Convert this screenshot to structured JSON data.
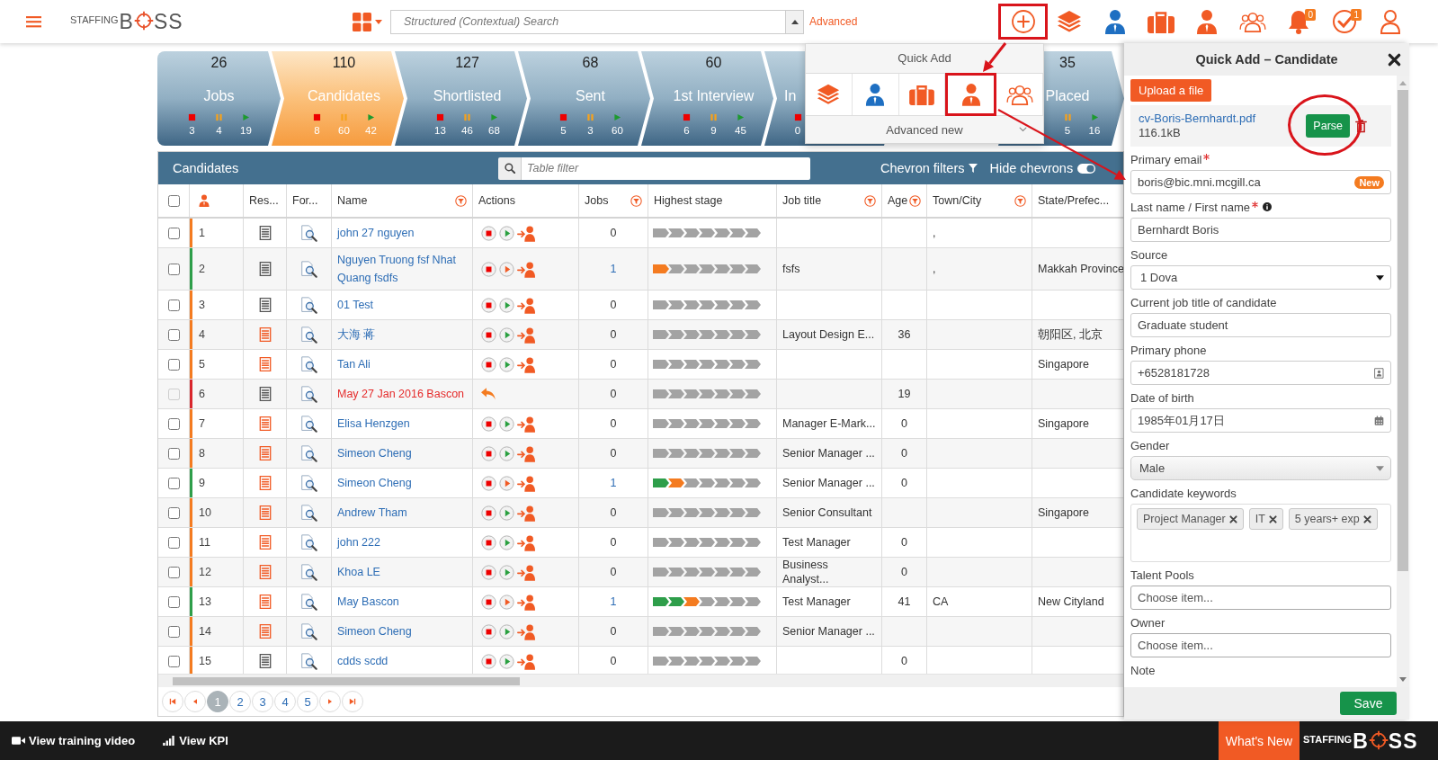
{
  "topbar": {
    "logo": {
      "small": "STAFFING",
      "left": "B",
      "right": "SS"
    },
    "search": {
      "placeholder": "Structured (Contextual) Search"
    },
    "advanced_link": "Advanced",
    "icons": [
      {
        "kind": "add",
        "highlighted": true
      },
      {
        "kind": "layers",
        "highlighted": false
      },
      {
        "kind": "person-blue",
        "highlighted": false
      },
      {
        "kind": "briefcase",
        "highlighted": false
      },
      {
        "kind": "person",
        "highlighted": false
      },
      {
        "kind": "group",
        "highlighted": false
      },
      {
        "kind": "bell",
        "highlighted": false,
        "badge": "0"
      },
      {
        "kind": "check",
        "highlighted": false,
        "badge": "1"
      },
      {
        "kind": "user",
        "highlighted": false
      }
    ]
  },
  "chevrons": [
    {
      "count": "26",
      "label": "Jobs",
      "selected": false,
      "stats": [
        {
          "kind": "stopped",
          "value": "3"
        },
        {
          "kind": "paused",
          "value": "4"
        },
        {
          "kind": "running",
          "value": "19"
        }
      ]
    },
    {
      "count": "110",
      "label": "Candidates",
      "selected": true,
      "stats": [
        {
          "kind": "stopped",
          "value": "8"
        },
        {
          "kind": "paused",
          "value": "60"
        },
        {
          "kind": "running",
          "value": "42"
        }
      ]
    },
    {
      "count": "127",
      "label": "Shortlisted",
      "selected": false,
      "stats": [
        {
          "kind": "stopped",
          "value": "13"
        },
        {
          "kind": "paused",
          "value": "46"
        },
        {
          "kind": "running",
          "value": "68"
        }
      ]
    },
    {
      "count": "68",
      "label": "Sent",
      "selected": false,
      "stats": [
        {
          "kind": "stopped",
          "value": "5"
        },
        {
          "kind": "paused",
          "value": "3"
        },
        {
          "kind": "running",
          "value": "60"
        }
      ]
    },
    {
      "count": "60",
      "label": "1st Interview",
      "selected": false,
      "stats": [
        {
          "kind": "stopped",
          "value": "6"
        },
        {
          "kind": "paused",
          "value": "9"
        },
        {
          "kind": "running",
          "value": "45"
        }
      ]
    },
    {
      "label": "In",
      "selected": false,
      "stats": [
        {
          "kind": "stopped",
          "value": "0"
        }
      ]
    },
    {
      "count": "35",
      "label": "Placed",
      "selected": false,
      "stats": [
        {
          "kind": "paused",
          "value": "5"
        },
        {
          "kind": "running",
          "value": "16"
        }
      ]
    }
  ],
  "quick_add": {
    "title": "Quick Add",
    "items": [
      {
        "kind": "layers",
        "highlighted": false
      },
      {
        "kind": "person-blue",
        "highlighted": false
      },
      {
        "kind": "briefcase",
        "highlighted": false
      },
      {
        "kind": "person",
        "highlighted": true
      },
      {
        "kind": "group",
        "highlighted": false
      }
    ],
    "advanced": "Advanced new"
  },
  "table": {
    "title": "Candidates",
    "filter_placeholder": "Table filter",
    "chevron_filters": "Chevron filters",
    "hide_chevrons": "Hide chevrons",
    "columns": [
      {
        "kind": "checkbox",
        "checked": false
      },
      {
        "kind": "person"
      },
      {
        "kind": "text",
        "title": "Res..."
      },
      {
        "kind": "text",
        "title": "For..."
      },
      {
        "kind": "text",
        "title": "Name",
        "filter": true
      },
      {
        "kind": "text",
        "title": "Actions"
      },
      {
        "kind": "text",
        "title": "Jobs",
        "filter": true
      },
      {
        "kind": "text",
        "title": "Highest stage"
      },
      {
        "kind": "text",
        "title": "Job title",
        "filter": true
      },
      {
        "kind": "text",
        "title": "Age",
        "filter": true
      },
      {
        "kind": "text",
        "title": "Town/City",
        "filter": true
      },
      {
        "kind": "text",
        "title": "State/Prefec..."
      }
    ],
    "rows": [
      {
        "number": "1",
        "color": "#f47b20",
        "checked": false,
        "kind": "active",
        "resume_parsed": false,
        "name": "john 27 nguyen",
        "pipeline": false,
        "jobs": "0",
        "stages": [
          {
            "color": "#a3a3a3"
          },
          {
            "color": "#a3a3a3"
          },
          {
            "color": "#a3a3a3"
          },
          {
            "color": "#a3a3a3"
          },
          {
            "color": "#a3a3a3"
          },
          {
            "color": "#a3a3a3"
          },
          {
            "color": "#a3a3a3"
          }
        ],
        "town": ","
      },
      {
        "number": "2",
        "color": "#2e9e4a",
        "checked": false,
        "kind": "active",
        "resume_parsed": false,
        "name": "Nguyen Truong fsf Nhat Quang fsdfs",
        "pipeline": true,
        "jobs": "1",
        "stages": [
          {
            "color": "#f47b20"
          },
          {
            "color": "#a3a3a3"
          },
          {
            "color": "#a3a3a3"
          },
          {
            "color": "#a3a3a3"
          },
          {
            "color": "#a3a3a3"
          },
          {
            "color": "#a3a3a3"
          },
          {
            "color": "#a3a3a3"
          }
        ],
        "job_title": "fsfs",
        "town": ",",
        "state": "Makkah Province"
      },
      {
        "number": "3",
        "color": "#f47b20",
        "checked": false,
        "kind": "active",
        "resume_parsed": false,
        "name": "01 Test",
        "pipeline": false,
        "jobs": "0",
        "stages": [
          {
            "color": "#a3a3a3"
          },
          {
            "color": "#a3a3a3"
          },
          {
            "color": "#a3a3a3"
          },
          {
            "color": "#a3a3a3"
          },
          {
            "color": "#a3a3a3"
          },
          {
            "color": "#a3a3a3"
          },
          {
            "color": "#a3a3a3"
          }
        ]
      },
      {
        "number": "4",
        "color": "#f47b20",
        "checked": false,
        "kind": "active",
        "resume_parsed": true,
        "name": "大海 蒋",
        "pipeline": false,
        "jobs": "0",
        "stages": [
          {
            "color": "#a3a3a3"
          },
          {
            "color": "#a3a3a3"
          },
          {
            "color": "#a3a3a3"
          },
          {
            "color": "#a3a3a3"
          },
          {
            "color": "#a3a3a3"
          },
          {
            "color": "#a3a3a3"
          },
          {
            "color": "#a3a3a3"
          }
        ],
        "job_title": "Layout Design E...",
        "age": "36",
        "state": "朝阳区, 北京"
      },
      {
        "number": "5",
        "color": "#f47b20",
        "checked": false,
        "kind": "active",
        "resume_parsed": true,
        "name": "Tan Ali",
        "pipeline": false,
        "jobs": "0",
        "stages": [
          {
            "color": "#a3a3a3"
          },
          {
            "color": "#a3a3a3"
          },
          {
            "color": "#a3a3a3"
          },
          {
            "color": "#a3a3a3"
          },
          {
            "color": "#a3a3a3"
          },
          {
            "color": "#a3a3a3"
          },
          {
            "color": "#a3a3a3"
          }
        ],
        "state": "Singapore"
      },
      {
        "number": "6",
        "color": "#d9262c",
        "checked": false,
        "kind": "deleted",
        "resume_parsed": false,
        "name": "May 27 Jan 2016 Bascon",
        "jobs": "0",
        "stages": [
          {
            "color": "#a3a3a3"
          },
          {
            "color": "#a3a3a3"
          },
          {
            "color": "#a3a3a3"
          },
          {
            "color": "#a3a3a3"
          },
          {
            "color": "#a3a3a3"
          },
          {
            "color": "#a3a3a3"
          },
          {
            "color": "#a3a3a3"
          }
        ],
        "age": "19"
      },
      {
        "number": "7",
        "color": "#f47b20",
        "checked": false,
        "kind": "active",
        "resume_parsed": true,
        "name": "Elisa Henzgen",
        "pipeline": false,
        "jobs": "0",
        "stages": [
          {
            "color": "#a3a3a3"
          },
          {
            "color": "#a3a3a3"
          },
          {
            "color": "#a3a3a3"
          },
          {
            "color": "#a3a3a3"
          },
          {
            "color": "#a3a3a3"
          },
          {
            "color": "#a3a3a3"
          },
          {
            "color": "#a3a3a3"
          }
        ],
        "job_title": "Manager E-Mark...",
        "age": "0",
        "state": "Singapore"
      },
      {
        "number": "8",
        "color": "#f47b20",
        "checked": false,
        "kind": "active",
        "resume_parsed": true,
        "name": "Simeon Cheng",
        "pipeline": false,
        "jobs": "0",
        "stages": [
          {
            "color": "#a3a3a3"
          },
          {
            "color": "#a3a3a3"
          },
          {
            "color": "#a3a3a3"
          },
          {
            "color": "#a3a3a3"
          },
          {
            "color": "#a3a3a3"
          },
          {
            "color": "#a3a3a3"
          },
          {
            "color": "#a3a3a3"
          }
        ],
        "job_title": "Senior Manager ...",
        "age": "0"
      },
      {
        "number": "9",
        "color": "#2e9e4a",
        "checked": false,
        "kind": "active",
        "resume_parsed": true,
        "name": "Simeon Cheng",
        "pipeline": true,
        "jobs": "1",
        "stages": [
          {
            "color": "#2e9e4a"
          },
          {
            "color": "#f47b20"
          },
          {
            "color": "#a3a3a3"
          },
          {
            "color": "#a3a3a3"
          },
          {
            "color": "#a3a3a3"
          },
          {
            "color": "#a3a3a3"
          },
          {
            "color": "#a3a3a3"
          }
        ],
        "job_title": "Senior Manager ...",
        "age": "0"
      },
      {
        "number": "10",
        "color": "#f47b20",
        "checked": false,
        "kind": "active",
        "resume_parsed": true,
        "name": "Andrew Tham",
        "pipeline": false,
        "jobs": "0",
        "stages": [
          {
            "color": "#a3a3a3"
          },
          {
            "color": "#a3a3a3"
          },
          {
            "color": "#a3a3a3"
          },
          {
            "color": "#a3a3a3"
          },
          {
            "color": "#a3a3a3"
          },
          {
            "color": "#a3a3a3"
          },
          {
            "color": "#a3a3a3"
          }
        ],
        "job_title": "Senior Consultant",
        "state": "Singapore"
      },
      {
        "number": "11",
        "color": "#f47b20",
        "checked": false,
        "kind": "active",
        "resume_parsed": true,
        "name": "john 222",
        "pipeline": false,
        "jobs": "0",
        "stages": [
          {
            "color": "#a3a3a3"
          },
          {
            "color": "#a3a3a3"
          },
          {
            "color": "#a3a3a3"
          },
          {
            "color": "#a3a3a3"
          },
          {
            "color": "#a3a3a3"
          },
          {
            "color": "#a3a3a3"
          },
          {
            "color": "#a3a3a3"
          }
        ],
        "job_title": "Test Manager",
        "age": "0"
      },
      {
        "number": "12",
        "color": "#f47b20",
        "checked": false,
        "kind": "active",
        "resume_parsed": true,
        "name": "Khoa LE",
        "pipeline": false,
        "jobs": "0",
        "stages": [
          {
            "color": "#a3a3a3"
          },
          {
            "color": "#a3a3a3"
          },
          {
            "color": "#a3a3a3"
          },
          {
            "color": "#a3a3a3"
          },
          {
            "color": "#a3a3a3"
          },
          {
            "color": "#a3a3a3"
          },
          {
            "color": "#a3a3a3"
          }
        ],
        "job_title": "Business Analyst...",
        "age": "0"
      },
      {
        "number": "13",
        "color": "#2e9e4a",
        "checked": false,
        "kind": "active",
        "resume_parsed": true,
        "name": "May Bascon",
        "pipeline": true,
        "jobs": "1",
        "stages": [
          {
            "color": "#2e9e4a"
          },
          {
            "color": "#2e9e4a"
          },
          {
            "color": "#f47b20"
          },
          {
            "color": "#a3a3a3"
          },
          {
            "color": "#a3a3a3"
          },
          {
            "color": "#a3a3a3"
          },
          {
            "color": "#a3a3a3"
          }
        ],
        "job_title": "Test Manager",
        "age": "41",
        "town": "CA",
        "state": "New Cityland"
      },
      {
        "number": "14",
        "color": "#f47b20",
        "checked": false,
        "kind": "active",
        "resume_parsed": true,
        "name": "Simeon Cheng",
        "pipeline": false,
        "jobs": "0",
        "stages": [
          {
            "color": "#a3a3a3"
          },
          {
            "color": "#a3a3a3"
          },
          {
            "color": "#a3a3a3"
          },
          {
            "color": "#a3a3a3"
          },
          {
            "color": "#a3a3a3"
          },
          {
            "color": "#a3a3a3"
          },
          {
            "color": "#a3a3a3"
          }
        ],
        "job_title": "Senior Manager ..."
      },
      {
        "number": "15",
        "color": "#f47b20",
        "checked": false,
        "kind": "active",
        "resume_parsed": false,
        "name": "cdds scdd",
        "pipeline": false,
        "jobs": "0",
        "stages": [
          {
            "color": "#a3a3a3"
          },
          {
            "color": "#a3a3a3"
          },
          {
            "color": "#a3a3a3"
          },
          {
            "color": "#a3a3a3"
          },
          {
            "color": "#a3a3a3"
          },
          {
            "color": "#a3a3a3"
          },
          {
            "color": "#a3a3a3"
          }
        ],
        "age": "0"
      }
    ],
    "pages": [
      {
        "label": "1",
        "selected": true
      },
      {
        "label": "2",
        "selected": false
      },
      {
        "label": "3",
        "selected": false
      },
      {
        "label": "4",
        "selected": false
      },
      {
        "label": "5",
        "selected": false
      }
    ]
  },
  "drawer": {
    "title": "Quick Add – Candidate",
    "upload": "Upload a file",
    "file": {
      "name": "cv-Boris-Bernhardt.pdf",
      "size": "116.1kB",
      "parse": "Parse",
      "parse_highlighted": true
    },
    "fields": [
      {
        "label": "Primary email",
        "required": true,
        "kind": "text",
        "value": "boris@bic.mni.mcgill.ca",
        "badge": "New"
      },
      {
        "label": "Last name / First name",
        "required": true,
        "info": true,
        "kind": "text",
        "value": "Bernhardt Boris"
      },
      {
        "label": "Source",
        "kind": "select",
        "value": "1 Dova"
      },
      {
        "label": "Current job title of candidate",
        "kind": "text",
        "value": "Graduate student"
      },
      {
        "label": "Primary phone",
        "kind": "phone",
        "value": "+6528181728"
      },
      {
        "label": "Date of birth",
        "kind": "date",
        "value": "1985年01月17日"
      },
      {
        "label": "Gender",
        "kind": "dropdown",
        "value": "Male"
      },
      {
        "label": "Candidate keywords",
        "kind": "tags",
        "tags": [
          "Project Manager",
          "IT",
          "5 years+ exp"
        ]
      },
      {
        "label": "Talent Pools",
        "kind": "choose",
        "placeholder": "Choose item..."
      },
      {
        "label": "Owner",
        "kind": "choose",
        "placeholder": "Choose item..."
      },
      {
        "label": "Note",
        "kind": "label"
      }
    ],
    "save": "Save"
  },
  "footer": {
    "training": "View training video",
    "kpi": "View KPI",
    "whats_new": "What's New",
    "logo": {
      "small": "STAFFING",
      "left": "B",
      "right": "SS"
    }
  }
}
